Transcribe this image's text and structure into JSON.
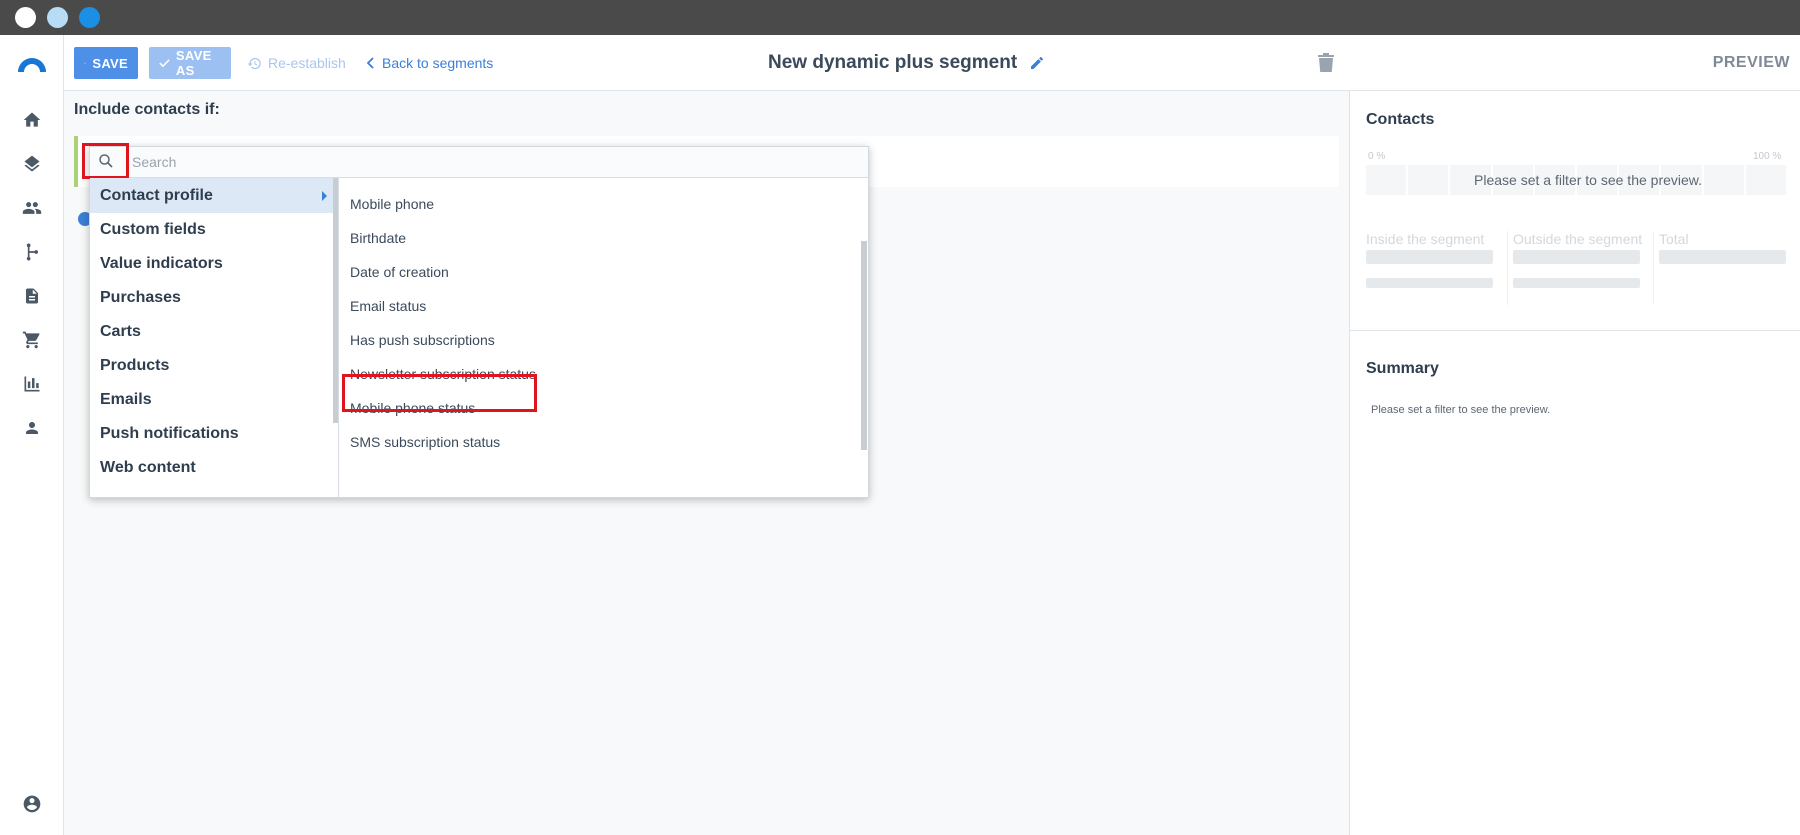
{
  "toolbar": {
    "save_label": "SAVE",
    "save_as_label": "SAVE AS",
    "reestablish_label": "Re-establish",
    "back_label": "Back to segments",
    "title": "New dynamic plus segment"
  },
  "main": {
    "include_label": "Include contacts if:"
  },
  "search": {
    "placeholder": "Search"
  },
  "categories": [
    {
      "label": "Contact profile",
      "active": true
    },
    {
      "label": "Custom fields"
    },
    {
      "label": "Value indicators"
    },
    {
      "label": "Purchases"
    },
    {
      "label": "Carts"
    },
    {
      "label": "Products"
    },
    {
      "label": "Emails"
    },
    {
      "label": "Push notifications"
    },
    {
      "label": "Web content"
    }
  ],
  "sub_items": [
    {
      "label": "Mobile phone"
    },
    {
      "label": "Birthdate"
    },
    {
      "label": "Date of creation"
    },
    {
      "label": "Email status"
    },
    {
      "label": "Has push subscriptions"
    },
    {
      "label": "Newsletter subscription status",
      "highlighted": true
    },
    {
      "label": "Mobile phone status"
    },
    {
      "label": "SMS subscription status"
    }
  ],
  "preview": {
    "title": "PREVIEW",
    "contacts_title": "Contacts",
    "pct_min": "0 %",
    "pct_max": "100 %",
    "empty_message": "Please set a filter to see the preview.",
    "inside_label": "Inside the segment",
    "outside_label": "Outside the segment",
    "total_label": "Total",
    "summary_title": "Summary",
    "summary_message": "Please set a filter to see the preview."
  },
  "icons": {
    "sidebar": [
      "home-icon",
      "layers-icon",
      "people-icon",
      "flow-icon",
      "document-icon",
      "cart-icon",
      "chart-icon",
      "person-icon",
      "account-icon"
    ]
  },
  "colors": {
    "primary": "#4e8fe8",
    "highlight_box": "#e0141e",
    "rule_accent": "#a9d176"
  }
}
